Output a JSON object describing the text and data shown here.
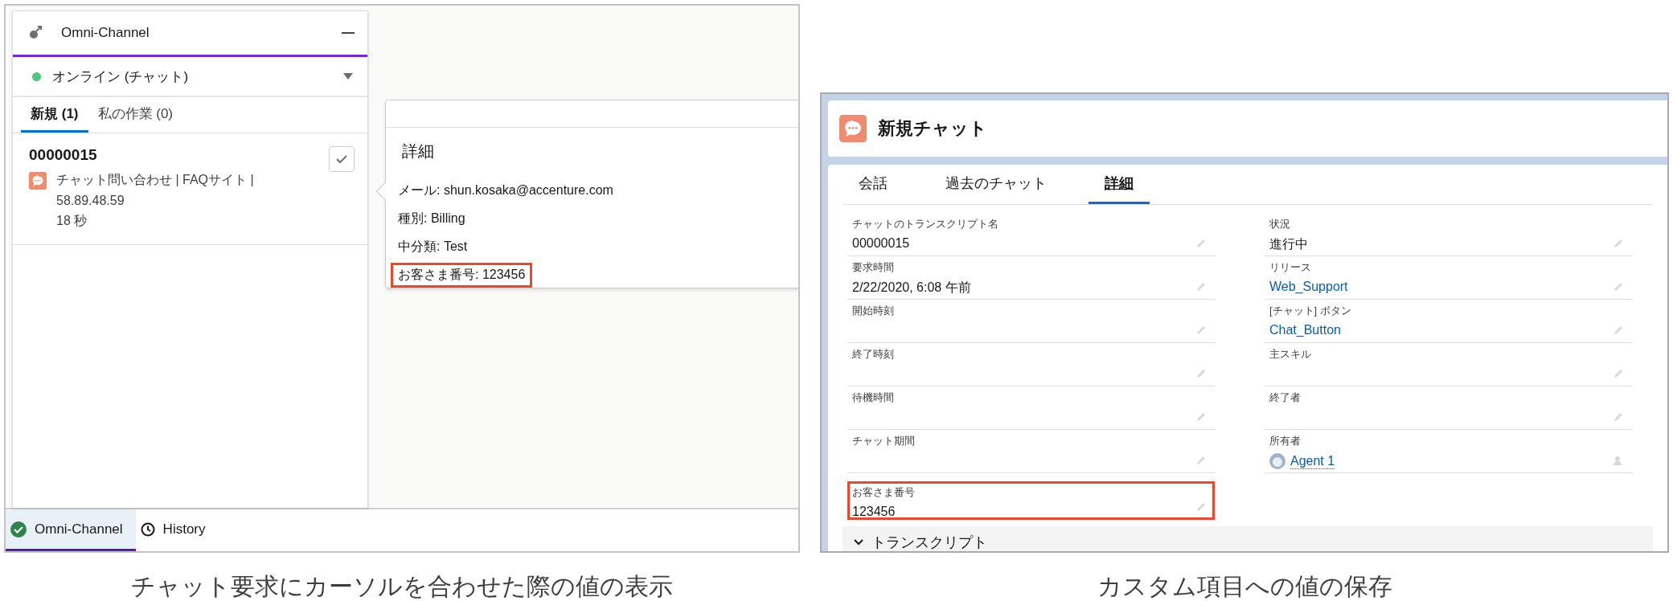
{
  "left_figure": {
    "omni_panel": {
      "title": "Omni-Channel",
      "status": {
        "label": "オンライン (チャット)",
        "color": "#4bca81"
      },
      "tabs": [
        {
          "label": "新規 (1)",
          "selected": true
        },
        {
          "label": "私の作業 (0)",
          "selected": false
        }
      ],
      "work_item": {
        "title": "00000015",
        "lines": [
          "チャット問い合わせ | FAQサイト |",
          "58.89.48.59",
          "18 秒"
        ]
      }
    },
    "popover": {
      "title": "詳細",
      "lines": [
        {
          "text": "メール: shun.kosaka@accenture.com",
          "highlighted": false
        },
        {
          "text": "種別: Billing",
          "highlighted": false
        },
        {
          "text": "中分類: Test",
          "highlighted": false
        },
        {
          "text": "お客さま番号: 123456",
          "highlighted": true
        }
      ]
    },
    "utility_bar": [
      {
        "label": "Omni-Channel",
        "selected": true,
        "kind": "status"
      },
      {
        "label": "History",
        "selected": false,
        "kind": "history"
      }
    ],
    "caption": "チャット要求にカーソルを合わせた際の値の表示"
  },
  "right_figure": {
    "header": {
      "title": "新規チャット"
    },
    "tabs": [
      {
        "label": "会話",
        "selected": false
      },
      {
        "label": "過去のチャット",
        "selected": false
      },
      {
        "label": "詳細",
        "selected": true
      }
    ],
    "columns": [
      [
        {
          "label": "チャットのトランスクリプト名",
          "value": "00000015",
          "kind": "text",
          "highlighted": false
        },
        {
          "label": "要求時間",
          "value": "2/22/2020, 6:08 午前",
          "kind": "text",
          "highlighted": false
        },
        {
          "label": "開始時刻",
          "kind": "text",
          "highlighted": false
        },
        {
          "label": "終了時刻",
          "kind": "text",
          "highlighted": false
        },
        {
          "label": "待機時間",
          "kind": "text",
          "highlighted": false
        },
        {
          "label": "チャット期間",
          "kind": "text",
          "highlighted": false
        },
        {
          "label": "お客さま番号",
          "value": "123456",
          "kind": "text",
          "highlighted": true
        }
      ],
      [
        {
          "label": "状況",
          "value": "進行中",
          "kind": "text",
          "highlighted": false
        },
        {
          "label": "リリース",
          "value": "Web_Support",
          "kind": "link",
          "highlighted": false
        },
        {
          "label": "[チャット] ボタン",
          "value": "Chat_Button",
          "kind": "link",
          "highlighted": false
        },
        {
          "label": "主スキル",
          "kind": "text",
          "highlighted": false
        },
        {
          "label": "終了者",
          "kind": "text",
          "highlighted": false
        },
        {
          "label": "所有者",
          "value": "Agent 1",
          "kind": "user",
          "highlighted": false
        }
      ]
    ],
    "section": {
      "title": "トランスクリプト",
      "expanded": true
    },
    "caption": "カスタム項目への値の保存"
  }
}
